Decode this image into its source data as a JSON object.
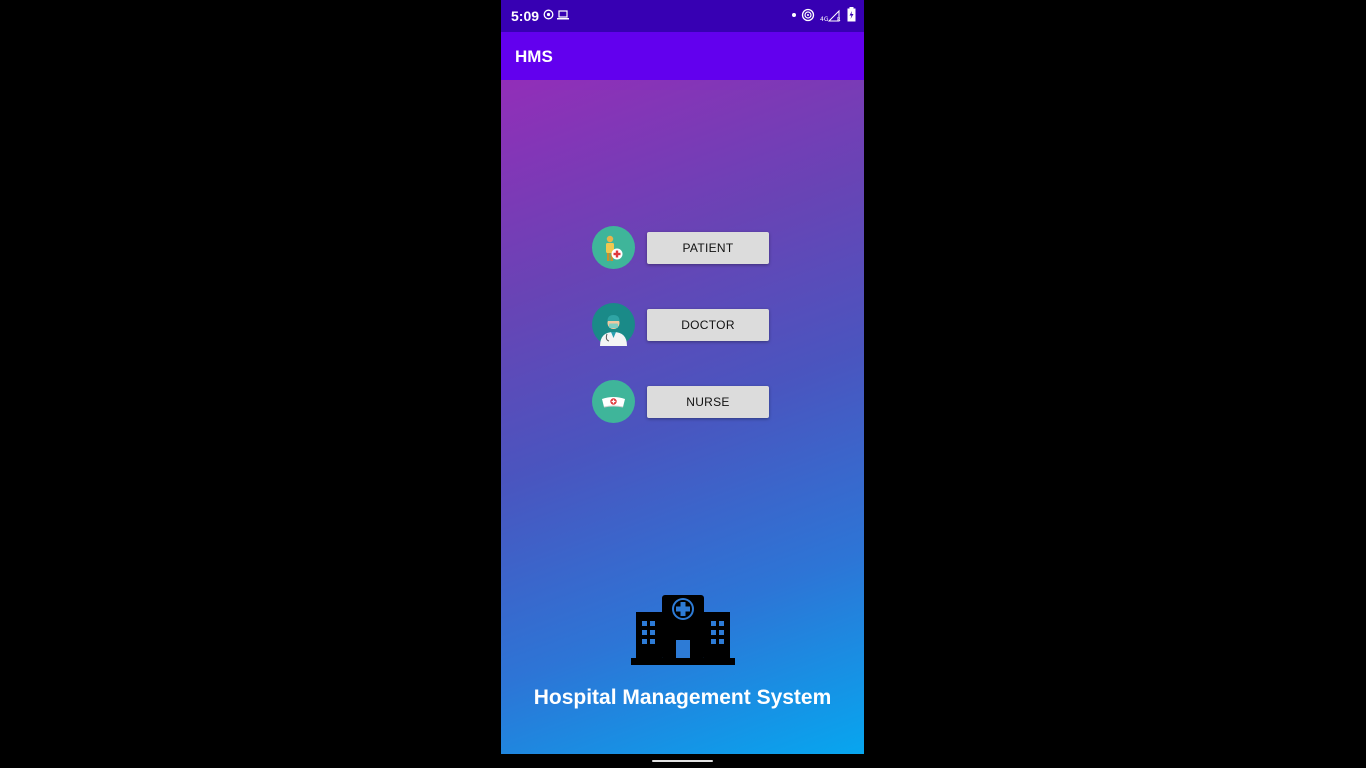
{
  "status_bar": {
    "time": "5:09",
    "icons": [
      "hotspot-icon",
      "laptop-icon",
      "dot-icon",
      "wifi-calling-icon",
      "signal-icon",
      "battery-charging-icon"
    ]
  },
  "app_bar": {
    "title": "HMS"
  },
  "roles": [
    {
      "label": "PATIENT",
      "icon": "patient-icon"
    },
    {
      "label": "DOCTOR",
      "icon": "doctor-icon"
    },
    {
      "label": "NURSE",
      "icon": "nurse-cap-icon"
    }
  ],
  "footer": {
    "icon": "hospital-building-icon",
    "app_name": "Hospital Management System"
  },
  "colors": {
    "status_bar": "#3700b3",
    "app_bar": "#6200ee",
    "button_bg": "#dcdcdc",
    "gradient_top": "#922eb8",
    "gradient_bottom": "#07a6ef"
  }
}
